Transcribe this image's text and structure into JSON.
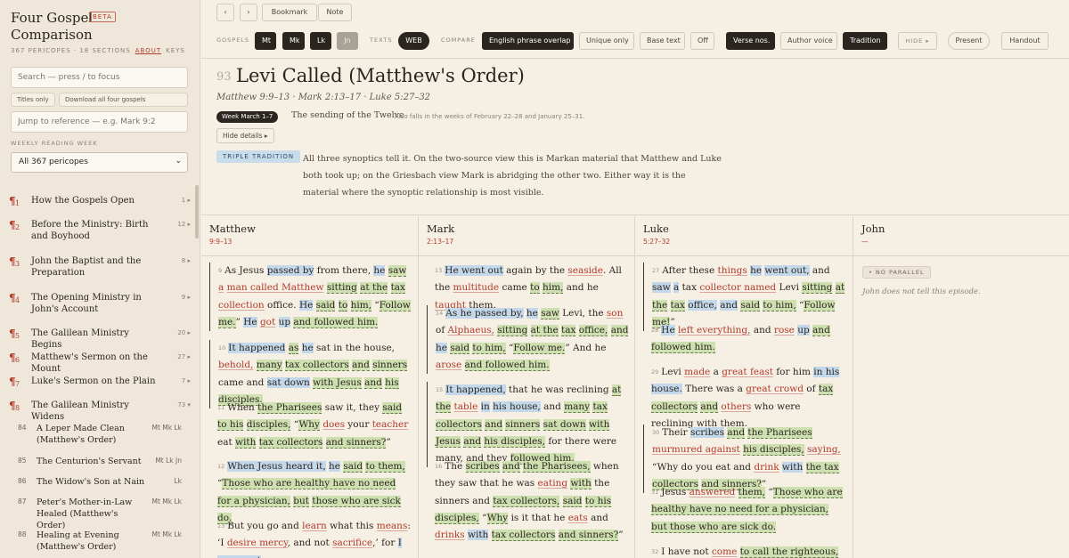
{
  "sidebar": {
    "title": "Four Gospel Comparison",
    "badge": "BETA",
    "stats": "367 PERICOPES · 18 SECTIONS",
    "about": "ABOUT",
    "keys": "KEYS",
    "search_placeholder": "Search — press / to focus",
    "titles_only": "Titles only",
    "download": "Download all four gospels",
    "jump_placeholder": "Jump to reference — e.g. Mark 9:2",
    "weekly_label": "WEEKLY READING WEEK",
    "week_select": "All 367 pericopes",
    "sections": [
      {
        "num": "1",
        "title": "How the Gospels Open",
        "count": "1 ▸"
      },
      {
        "num": "2",
        "title": "Before the Ministry: Birth and Boyhood",
        "count": "12 ▸"
      },
      {
        "num": "3",
        "title": "John the Baptist and the Preparation",
        "count": "8 ▸"
      },
      {
        "num": "4",
        "title": "The Opening Ministry in John's Account",
        "count": "9 ▸"
      },
      {
        "num": "5",
        "title": "The Galilean Ministry Begins",
        "count": "20 ▸"
      },
      {
        "num": "6",
        "title": "Matthew's Sermon on the Mount",
        "count": "27 ▸"
      },
      {
        "num": "7",
        "title": "Luke's Sermon on the Plain",
        "count": "7 ▸"
      },
      {
        "num": "8",
        "title": "The Galilean Ministry Widens",
        "count": "73 ▾"
      }
    ],
    "pericopes": [
      {
        "num": "84",
        "title": "A Leper Made Clean (Matthew's Order)",
        "gospels": "Mt Mk Lk"
      },
      {
        "num": "85",
        "title": "The Centurion's Servant",
        "gospels": "Mt Lk Jn"
      },
      {
        "num": "86",
        "title": "The Widow's Son at Nain",
        "gospels": "Lk"
      },
      {
        "num": "87",
        "title": "Peter's Mother-in-Law Healed (Matthew's Order)",
        "gospels": "Mt Mk Lk"
      },
      {
        "num": "88",
        "title": "Healing at Evening (Matthew's Order)",
        "gospels": "Mt Mk Lk"
      }
    ]
  },
  "toolbar": {
    "prev": "‹",
    "next": "›",
    "bookmark": "Bookmark",
    "note": "Note",
    "gospels_label": "GOSPELS",
    "gospels": [
      "Mt",
      "Mk",
      "Lk",
      "Jn"
    ],
    "texts_label": "TEXTS",
    "text": "WEB",
    "compare_label": "COMPARE",
    "compare": [
      "English phrase overlap",
      "Unique only",
      "Base text",
      "Off"
    ],
    "verse_nos": "Verse nos.",
    "author_voice": "Author voice",
    "tradition": "Tradition",
    "hide": "HIDE ▸",
    "present": "Present",
    "handout": "Handout"
  },
  "header": {
    "number": "93",
    "title": "Levi Called (Matthew's Order)",
    "refs": "Matthew 9:9–13 · Mark 2:13–17 · Luke 5:27–32",
    "week_badge": "Week March 1–7",
    "week_note": "The sending of the Twelve",
    "week_also": "Also falls in the weeks of February 22–28 and January 25–31.",
    "hide_details": "Hide details ▸",
    "tradition_badge": "TRIPLE TRADITION",
    "tradition_desc": "All three synoptics tell it. On the two-source view this is Markan material that Matthew and Luke both took up; on the Griesbach view Mark is abridging the other two. Either way it is the material where the synoptic relationship is most visible."
  },
  "columns": {
    "matthew": {
      "name": "Matthew",
      "ref": "9:9–13"
    },
    "mark": {
      "name": "Mark",
      "ref": "2:13–17"
    },
    "luke": {
      "name": "Luke",
      "ref": "5:27–32"
    },
    "john": {
      "name": "John",
      "ref": "—",
      "badge": "• NO PARALLEL",
      "note": "John does not tell this episode."
    }
  },
  "colors": {
    "accent": "#b23b2c",
    "overlap_green": "#cfe0b0",
    "overlap_blue": "#c3d8ea",
    "background": "#f5efe4"
  }
}
